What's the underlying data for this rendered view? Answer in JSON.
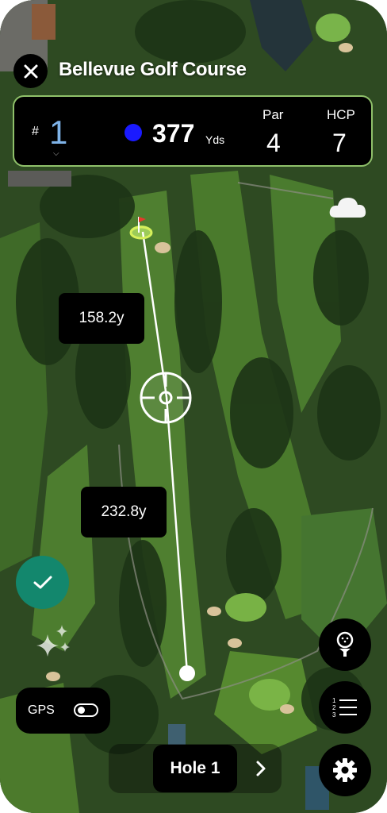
{
  "header": {
    "title": "Bellevue Golf Course",
    "close_icon": "close-icon"
  },
  "hole_card": {
    "hash": "#",
    "hole_number": "1",
    "distance": "377",
    "distance_unit": "Yds",
    "par_label": "Par",
    "par_value": "4",
    "hcp_label": "HCP",
    "hcp_value": "7",
    "accent_color": "#8fc06a",
    "hole_number_color": "#7fb3e8",
    "player_dot_color": "#1a1aff"
  },
  "map": {
    "weather_icon": "cloud-icon",
    "flag_icon": "flag-icon",
    "target_icon": "crosshair-icon",
    "distances": [
      "158.2y",
      "232.8y"
    ]
  },
  "controls": {
    "confirm_icon": "check-icon",
    "confirm_color": "#13876d",
    "sparkle_icon": "sparkle-icon",
    "gps_label": "GPS",
    "gps_enabled": false,
    "tee_icon": "golf-ball-tee-icon",
    "scorecard_icon": "numbered-list-icon",
    "settings_icon": "gear-icon",
    "hole_nav_label": "Hole 1",
    "next_icon": "chevron-right-icon"
  }
}
